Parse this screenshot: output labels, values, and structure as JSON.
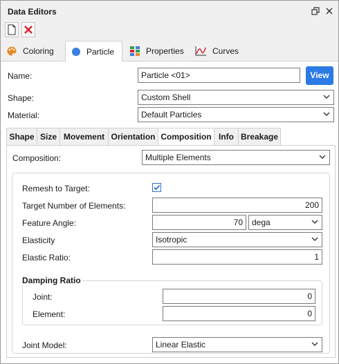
{
  "window": {
    "title": "Data Editors",
    "restore_icon": "restore-window-icon",
    "close_icon": "close-icon"
  },
  "toolbar": {
    "new_icon": "new-document-icon",
    "delete_icon": "delete-icon"
  },
  "main_tabs": [
    {
      "label": "Coloring",
      "icon": "palette-icon"
    },
    {
      "label": "Particle",
      "icon": "particle-dot-icon"
    },
    {
      "label": "Properties",
      "icon": "properties-grid-icon"
    },
    {
      "label": "Curves",
      "icon": "curve-chart-icon"
    }
  ],
  "form": {
    "name_label": "Name:",
    "name_value": "Particle <01>",
    "view_button": "View",
    "shape_label": "Shape:",
    "shape_value": "Custom Shell",
    "material_label": "Material:",
    "material_value": "Default Particles"
  },
  "sub_tabs": [
    "Shape",
    "Size",
    "Movement",
    "Orientation",
    "Composition",
    "Info",
    "Breakage"
  ],
  "composition": {
    "label": "Composition:",
    "value": "Multiple Elements",
    "remesh_label": "Remesh to Target:",
    "remesh_checked": true,
    "target_label": "Target Number of Elements:",
    "target_value": "200",
    "feature_label": "Feature Angle:",
    "feature_value": "70",
    "feature_unit": "dega",
    "elasticity_label": "Elasticity",
    "elasticity_value": "Isotropic",
    "elastic_ratio_label": "Elastic Ratio:",
    "elastic_ratio_value": "1",
    "damping_title": "Damping Ratio",
    "joint_label": "Joint:",
    "joint_value": "0",
    "element_label": "Element:",
    "element_value": "0",
    "joint_model_label": "Joint Model:",
    "joint_model_value": "Linear Elastic"
  },
  "colors": {
    "accent": "#2c7be5",
    "delete": "#d9262f"
  }
}
